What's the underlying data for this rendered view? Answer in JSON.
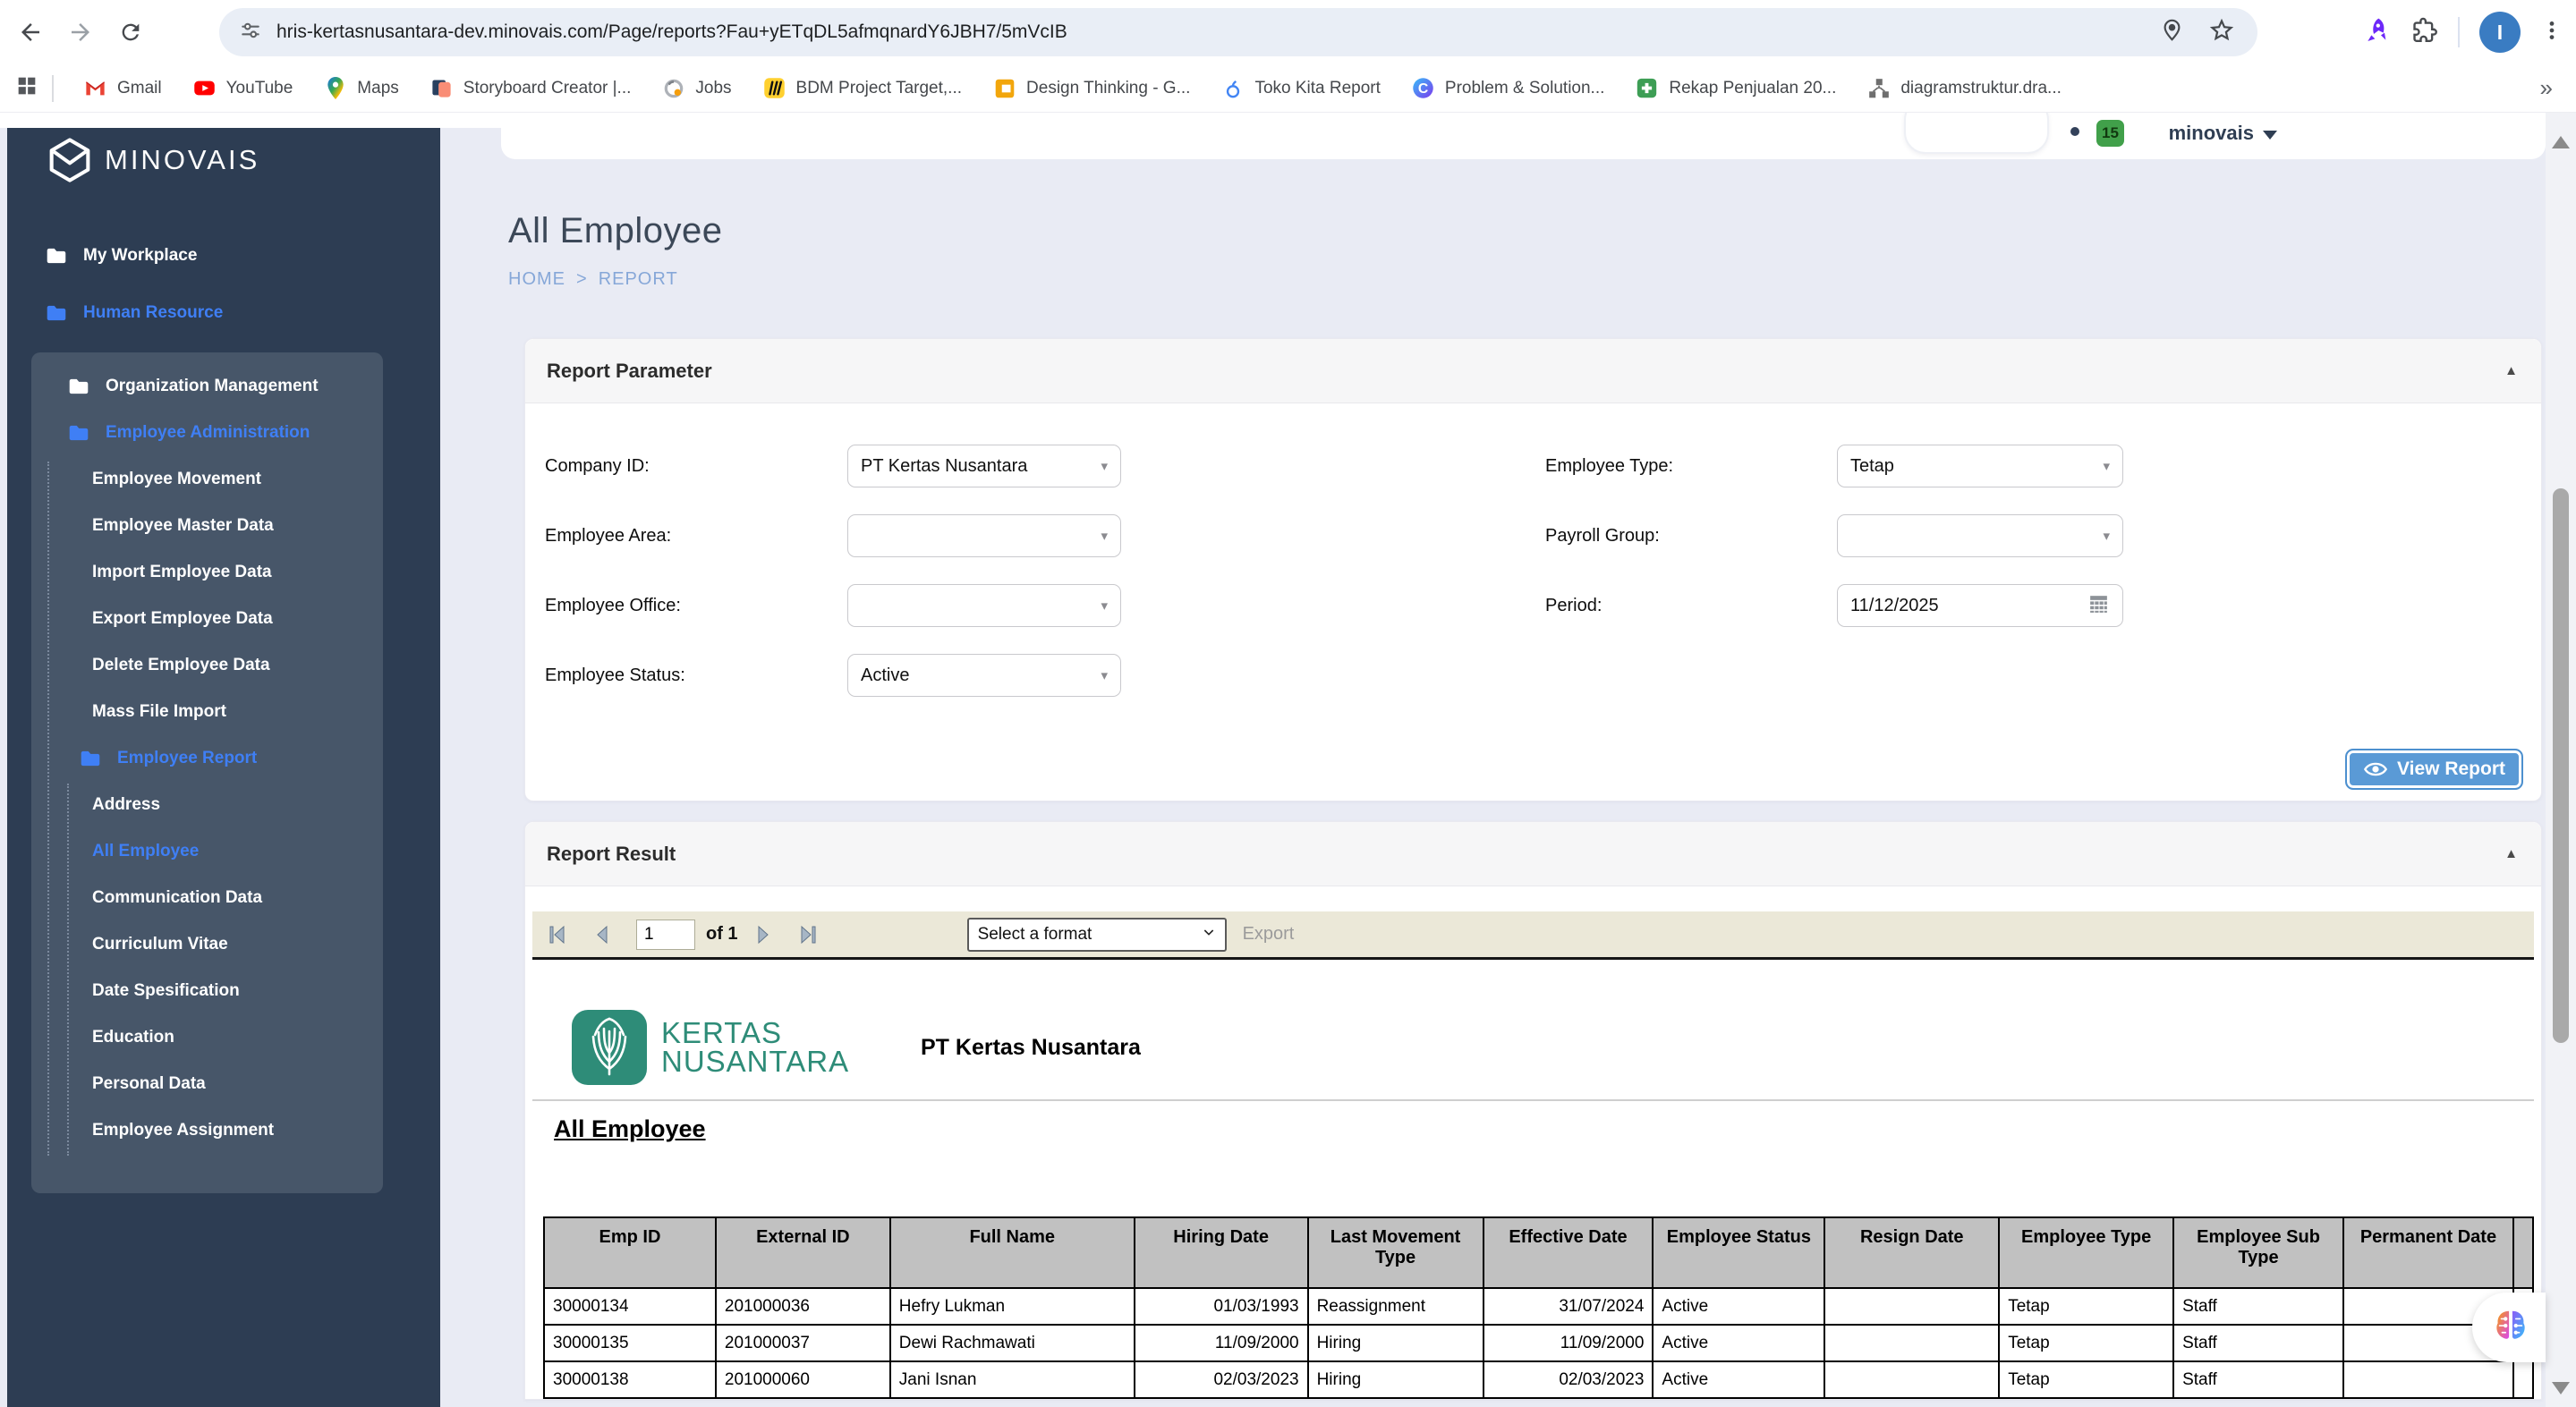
{
  "browser": {
    "url_domain": "hris-kertasnusantara-dev.minovais.com",
    "url_path": "/Page/reports?Fau+yETqDL5afmqnardY6JBH7/5mVcIB",
    "avatar_initial": "I",
    "bookmarks": [
      {
        "label": "Gmail",
        "icon": "gmail"
      },
      {
        "label": "YouTube",
        "icon": "youtube"
      },
      {
        "label": "Maps",
        "icon": "maps"
      },
      {
        "label": "Storyboard Creator |...",
        "icon": "storyboard"
      },
      {
        "label": "Jobs",
        "icon": "jobs"
      },
      {
        "label": "BDM Project Target,...",
        "icon": "miro"
      },
      {
        "label": "Design Thinking - G...",
        "icon": "jam"
      },
      {
        "label": "Toko Kita Report",
        "icon": "toko"
      },
      {
        "label": "Problem & Solution...",
        "icon": "coggle"
      },
      {
        "label": "Rekap Penjualan 20...",
        "icon": "sheet"
      },
      {
        "label": "diagramstruktur.dra...",
        "icon": "drawio"
      }
    ],
    "overflow_chevron": "»"
  },
  "appbar": {
    "notification_count": "15",
    "account_label": "minovais"
  },
  "sidebar": {
    "logo_text": "MINOVAIS",
    "items": [
      {
        "label": "My Workplace",
        "kind": "root",
        "active": false
      },
      {
        "label": "Human Resource",
        "kind": "root",
        "active": true
      },
      {
        "label": "Organization Management",
        "kind": "group",
        "active": false
      },
      {
        "label": "Employee Administration",
        "kind": "group",
        "active": true
      },
      {
        "label": "Employee Movement",
        "kind": "leaf",
        "active": false
      },
      {
        "label": "Employee Master Data",
        "kind": "leaf",
        "active": false
      },
      {
        "label": "Import Employee Data",
        "kind": "leaf",
        "active": false
      },
      {
        "label": "Export Employee Data",
        "kind": "leaf",
        "active": false
      },
      {
        "label": "Delete Employee Data",
        "kind": "leaf",
        "active": false
      },
      {
        "label": "Mass File Import",
        "kind": "leaf",
        "active": false
      },
      {
        "label": "Employee Report",
        "kind": "subgroup",
        "active": true
      },
      {
        "label": "Address",
        "kind": "leaf",
        "active": false
      },
      {
        "label": "All Employee",
        "kind": "leaf",
        "active": true
      },
      {
        "label": "Communication Data",
        "kind": "leaf",
        "active": false
      },
      {
        "label": "Curriculum Vitae",
        "kind": "leaf",
        "active": false
      },
      {
        "label": "Date Spesification",
        "kind": "leaf",
        "active": false
      },
      {
        "label": "Education",
        "kind": "leaf",
        "active": false
      },
      {
        "label": "Personal Data",
        "kind": "leaf",
        "active": false
      },
      {
        "label": "Employee Assignment",
        "kind": "leaf",
        "active": false
      }
    ]
  },
  "page": {
    "title": "All Employee",
    "breadcrumb_home": "HOME",
    "breadcrumb_sep": ">",
    "breadcrumb_current": "REPORT"
  },
  "report_parameter": {
    "title": "Report Parameter",
    "fields_left": [
      {
        "label": "Company ID:",
        "value": "PT Kertas Nusantara",
        "type": "select"
      },
      {
        "label": "Employee Area:",
        "value": "",
        "type": "select"
      },
      {
        "label": "Employee Office:",
        "value": "",
        "type": "select"
      },
      {
        "label": "Employee Status:",
        "value": "Active",
        "type": "select"
      }
    ],
    "fields_right": [
      {
        "label": "Employee Type:",
        "value": "Tetap",
        "type": "select"
      },
      {
        "label": "Payroll Group:",
        "value": "",
        "type": "select"
      },
      {
        "label": "Period:",
        "value": "11/12/2025",
        "type": "date"
      }
    ],
    "view_report_label": "View Report"
  },
  "report_result": {
    "title": "Report Result",
    "page_value": "1",
    "of_label": "of 1",
    "format_placeholder": "Select a format",
    "export_label": "Export",
    "logo_line1": "KERTAS",
    "logo_line2": "NUSANTARA",
    "company_name": "PT Kertas Nusantara",
    "report_heading": "All Employee",
    "table": {
      "columns": [
        "Emp ID",
        "External ID",
        "Full Name",
        "Hiring Date",
        "Last Movement Type",
        "Effective Date",
        "Employee Status",
        "Resign Date",
        "Employee Type",
        "Employee Sub Type",
        "Permanent Date"
      ],
      "rows": [
        [
          "30000134",
          "201000036",
          "Hefry Lukman",
          "01/03/1993",
          "Reassignment",
          "31/07/2024",
          "Active",
          "",
          "Tetap",
          "Staff",
          ""
        ],
        [
          "30000135",
          "201000037",
          "Dewi Rachmawati",
          "11/09/2000",
          "Hiring",
          "11/09/2000",
          "Active",
          "",
          "Tetap",
          "Staff",
          ""
        ],
        [
          "30000138",
          "201000060",
          "Jani Isnan",
          "02/03/2023",
          "Hiring",
          "02/03/2023",
          "Active",
          "",
          "Tetap",
          "Staff",
          ""
        ]
      ]
    }
  },
  "colors": {
    "accent_blue": "#3f7ff5",
    "sidebar_bg": "#2d3d53",
    "sidebar_panel": "#475669",
    "button_blue": "#5a9ad6",
    "toolbar_beige": "#ebe8d8",
    "table_header_gray": "#c1c1c1",
    "logo_green": "#2e8c78",
    "badge_green": "#41a04a"
  }
}
